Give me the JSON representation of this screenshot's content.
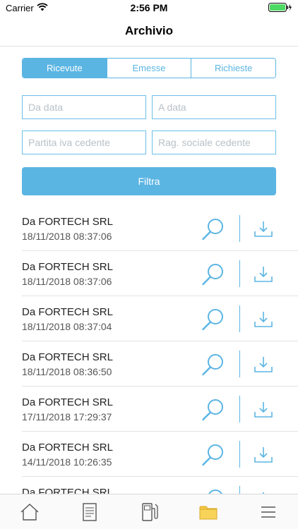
{
  "status_bar": {
    "carrier": "Carrier",
    "time": "2:56 PM"
  },
  "nav": {
    "title": "Archivio"
  },
  "segments": [
    {
      "label": "Ricevute",
      "active": true
    },
    {
      "label": "Emesse",
      "active": false
    },
    {
      "label": "Richieste",
      "active": false
    }
  ],
  "filters": {
    "da_data_placeholder": "Da data",
    "a_data_placeholder": "A data",
    "partita_iva_placeholder": "Partita iva cedente",
    "ragione_sociale_placeholder": "Rag. sociale cedente",
    "da_data_value": "",
    "a_data_value": "",
    "partita_iva_value": "",
    "ragione_sociale_value": "",
    "button_label": "Filtra"
  },
  "records": [
    {
      "title": "Da FORTECH SRL",
      "date": "18/11/2018 08:37:06"
    },
    {
      "title": "Da FORTECH SRL",
      "date": "18/11/2018 08:37:06"
    },
    {
      "title": "Da FORTECH SRL",
      "date": "18/11/2018 08:37:04"
    },
    {
      "title": "Da FORTECH SRL",
      "date": "18/11/2018 08:36:50"
    },
    {
      "title": "Da FORTECH SRL",
      "date": "17/11/2018 17:29:37"
    },
    {
      "title": "Da FORTECH SRL",
      "date": "14/11/2018 10:26:35"
    },
    {
      "title": "Da FORTECH SRL",
      "date": ""
    }
  ],
  "row_icons": {
    "search": "search-icon",
    "download": "download-icon"
  },
  "tabs": [
    {
      "icon": "home-icon",
      "active": false
    },
    {
      "icon": "document-icon",
      "active": false
    },
    {
      "icon": "fuel-pump-icon",
      "active": false
    },
    {
      "icon": "folder-icon",
      "active": true
    },
    {
      "icon": "menu-icon",
      "active": false
    }
  ],
  "colors": {
    "accent": "#5bb5e3",
    "folder": "#f5c842",
    "tab_icon": "#555555",
    "divider": "#e3e3e3"
  }
}
